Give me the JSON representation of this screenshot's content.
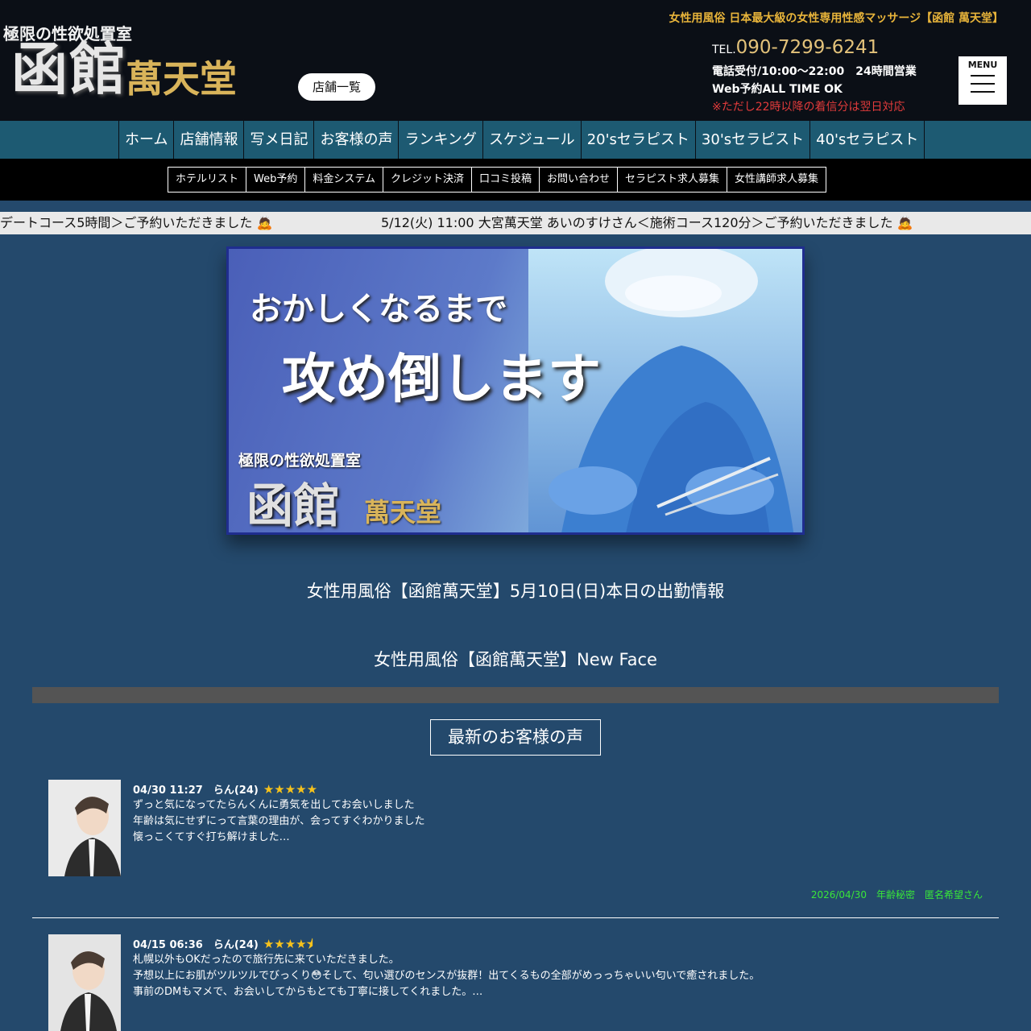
{
  "header": {
    "logo_small": "極限の性欲処置室",
    "logo_big": "函館",
    "logo_gold": "萬天堂",
    "store_list": "店舗一覧",
    "tagline": "女性用風俗 日本最大級の女性専用性感マッサージ【函館 萬天堂】",
    "tel_prefix": "TEL.",
    "tel_number": "090-7299-6241",
    "hours_line1": "電話受付/10:00〜22:00　24時間営業",
    "hours_line2": "Web予約ALL TIME OK",
    "hours_warning": "※ただし22時以降の着信分は翌日対応",
    "menu_label": "MENU"
  },
  "nav_primary": [
    "ホーム",
    "店舗情報",
    "写メ日記",
    "お客様の声",
    "ランキング",
    "スケジュール",
    "20'sセラピスト",
    "30'sセラピスト",
    "40'sセラピスト"
  ],
  "nav_secondary": [
    "ホテルリスト",
    "Web予約",
    "料金システム",
    "クレジット決済",
    "口コミ投稿",
    "お問い合わせ",
    "セラピスト求人募集",
    "女性講師求人募集"
  ],
  "ticker": {
    "item1": "デートコース5時間＞ご予約いただきました 🙇",
    "item2": "5/12(火) 11:00 大宮萬天堂 あいのすけさん＜施術コース120分＞ご予約いただきました 🙇"
  },
  "banner": {
    "line1": "おかしくなるまで",
    "line2": "攻め倒します",
    "brand_small": "極限の性欲処置室",
    "brand_big": "函館",
    "brand_gold": "萬天堂"
  },
  "sections": {
    "today": "女性用風俗【函館萬天堂】5月10日(日)本日の出勤情報",
    "new_face": "女性用風俗【函館萬天堂】New Face",
    "voices_heading": "最新のお客様の声"
  },
  "reviews": [
    {
      "meta": "04/30 11:27　らん(24)",
      "stars": "★★★★★",
      "rating": 5,
      "line1": "ずっと気になってたらんくんに勇気を出してお会いしました",
      "line2": "年齢は気にせずにって言葉の理由が、会ってすぐわかりました",
      "line3": "懐っこくてすぐ打ち解けました…",
      "footer": "2026/04/30　年齢秘密　匿名希望さん"
    },
    {
      "meta": "04/15 06:36　らん(24)",
      "stars": "★★★★⯨",
      "rating": 4.5,
      "line1": "札幌以外もOKだったので旅行先に来ていただきました。",
      "line2": "予想以上にお肌がツルツルでびっくり😳そして、匂い選びのセンスが抜群！出てくるもの全部がめっっちゃいい匂いで癒されました。",
      "line3": "事前のDMもマメで、お会いしてからもとても丁寧に接してくれました。…"
    }
  ],
  "colors": {
    "page_bg": "#24496c",
    "header_bg": "#0b0f16",
    "nav_bg": "#1d5a72",
    "accent_gold": "#e8b43a",
    "warning_red": "#e23b3b",
    "footer_green": "#39e639"
  }
}
